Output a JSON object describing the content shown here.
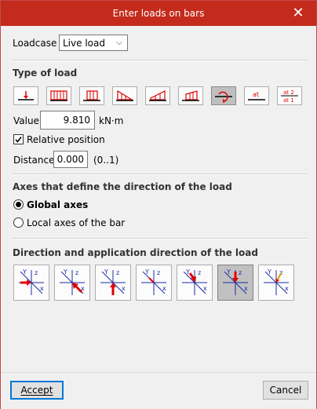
{
  "window": {
    "title": "Enter loads on bars",
    "close_label": "✕"
  },
  "loadcase": {
    "label": "Loadcase",
    "value": "Live load"
  },
  "type_of_load": {
    "heading": "Type of load",
    "buttons": [
      {
        "name": "point-load-icon",
        "selected": false
      },
      {
        "name": "uniform-load-icon",
        "selected": false
      },
      {
        "name": "partial-uniform-load-icon",
        "selected": false
      },
      {
        "name": "triangular-load-icon",
        "selected": false
      },
      {
        "name": "trapezoidal-load-icon",
        "selected": false
      },
      {
        "name": "partial-trapezoidal-load-icon",
        "selected": false
      },
      {
        "name": "moment-load-icon",
        "selected": true
      },
      {
        "name": "load-at-position-icon",
        "selected": false,
        "text": "at"
      },
      {
        "name": "load-between-positions-icon",
        "selected": false,
        "text_top": "at 2",
        "text_bottom": "at 1"
      }
    ]
  },
  "value": {
    "label": "Value",
    "value": "9.810",
    "unit": "kN·m"
  },
  "relative_position": {
    "label": "Relative position",
    "checked": true
  },
  "distance": {
    "label": "Distance",
    "value": "0.000",
    "range": "(0..1)"
  },
  "axes": {
    "heading": "Axes that define the direction of the load",
    "global": "Global axes",
    "local": "Local axes of the bar",
    "selected": "global"
  },
  "direction": {
    "heading": "Direction and application direction of the load",
    "buttons": [
      {
        "name": "direction-plus-x-icon",
        "selected": false
      },
      {
        "name": "direction-minus-x-icon",
        "selected": false
      },
      {
        "name": "direction-plus-y-icon",
        "selected": false
      },
      {
        "name": "direction-minus-y-icon",
        "selected": false
      },
      {
        "name": "direction-plus-z-icon",
        "selected": false
      },
      {
        "name": "direction-minus-z-icon",
        "selected": true
      },
      {
        "name": "direction-general-icon",
        "selected": false
      }
    ],
    "axis_labels": {
      "x": "x",
      "y": "y",
      "z": "z",
      "Y": "Y",
      "Z": "Z"
    }
  },
  "colors": {
    "titlebar": "#c42b1c",
    "load_red": "#e00000",
    "axis_blue": "#1a2aa8",
    "accent": "#0078d7"
  },
  "footer": {
    "accept": "Accept",
    "cancel": "Cancel"
  }
}
